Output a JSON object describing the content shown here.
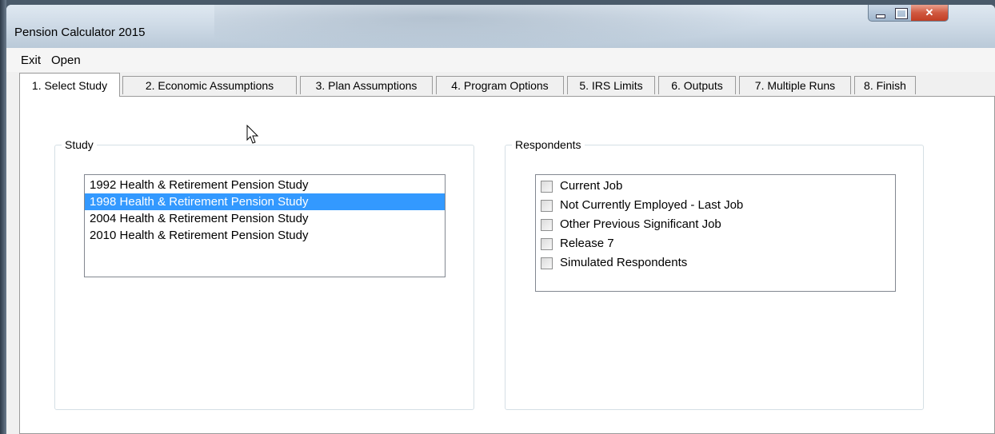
{
  "window": {
    "title": "Pension Calculator 2015"
  },
  "menu": {
    "items": [
      "Exit",
      "Open"
    ]
  },
  "tabs": [
    {
      "label": "1. Select Study",
      "active": true
    },
    {
      "label": "2. Economic Assumptions",
      "active": false
    },
    {
      "label": "3. Plan Assumptions",
      "active": false
    },
    {
      "label": "4. Program Options",
      "active": false
    },
    {
      "label": "5. IRS Limits",
      "active": false
    },
    {
      "label": "6. Outputs",
      "active": false
    },
    {
      "label": "7. Multiple Runs",
      "active": false
    },
    {
      "label": "8. Finish",
      "active": false
    }
  ],
  "study": {
    "label": "Study",
    "items": [
      "1992 Health & Retirement Pension Study",
      "1998 Health & Retirement Pension Study",
      "2004 Health & Retirement Pension Study",
      "2010 Health & Retirement Pension Study"
    ],
    "selected_index": 1
  },
  "respondents": {
    "label": "Respondents",
    "items": [
      {
        "label": "Current Job",
        "checked": false
      },
      {
        "label": "Not Currently Employed - Last Job",
        "checked": false
      },
      {
        "label": "Other Previous Significant Job",
        "checked": false
      },
      {
        "label": "Release 7",
        "checked": false
      },
      {
        "label": "Simulated Respondents",
        "checked": false
      }
    ]
  },
  "colors": {
    "selection": "#3399ff",
    "close_button": "#c94a31"
  }
}
